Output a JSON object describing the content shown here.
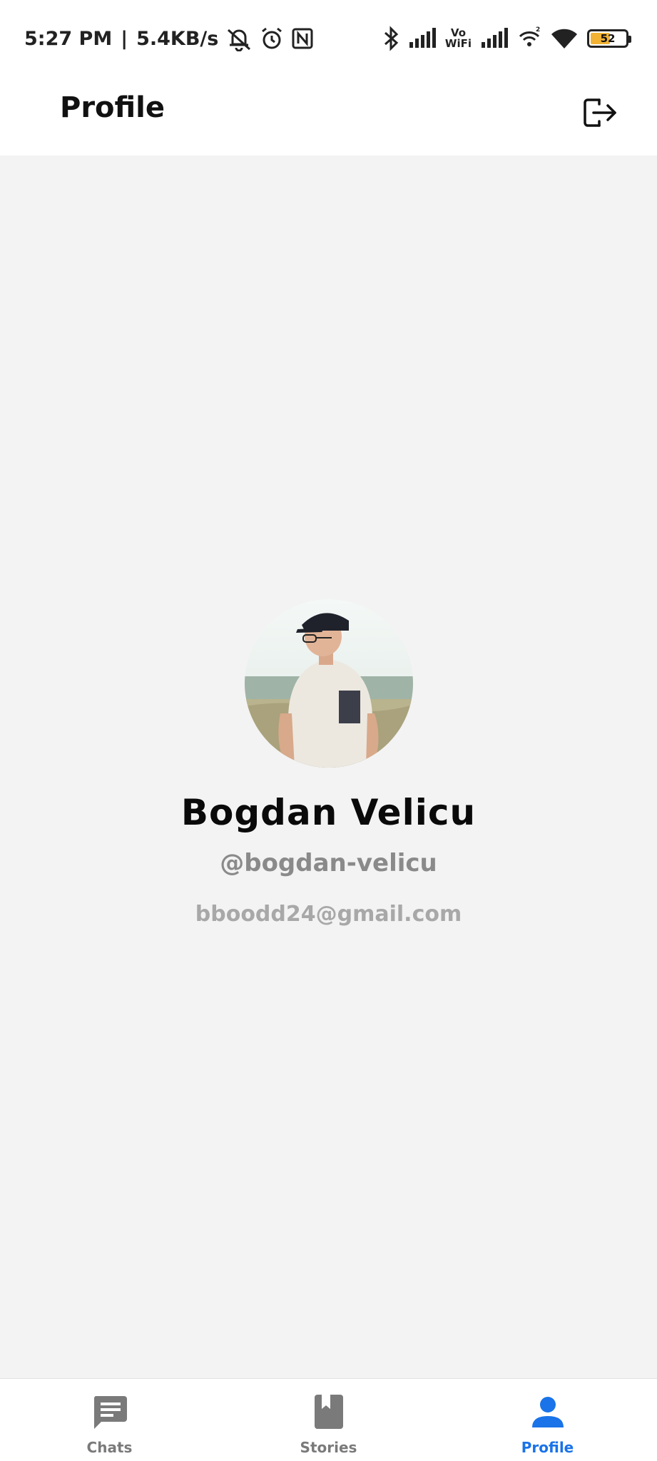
{
  "status_bar": {
    "time": "5:27 PM",
    "separator": "|",
    "network_speed": "5.4KB/s",
    "vowifi_top": "Vo",
    "vowifi_bottom": "WiFi",
    "battery_level": "52",
    "icons": [
      "bell-muted-icon",
      "alarm-icon",
      "nfc-icon",
      "bluetooth-icon",
      "signal-icon",
      "wifi-hotspot-icon",
      "wifi-icon",
      "battery-icon"
    ]
  },
  "header": {
    "title": "Profile",
    "logout_icon": "logout-icon"
  },
  "profile": {
    "display_name": "Bogdan Velicu",
    "username": "@bogdan-velicu",
    "email": "bboodd24@gmail.com"
  },
  "bottom_nav": {
    "items": [
      {
        "label": "Chats",
        "icon": "chat-icon",
        "active": false
      },
      {
        "label": "Stories",
        "icon": "book-icon",
        "active": false
      },
      {
        "label": "Profile",
        "icon": "person-icon",
        "active": true
      }
    ]
  },
  "colors": {
    "background": "#f3f3f3",
    "accent": "#1a73e8",
    "inactive": "#7a7a7a",
    "battery": "#f2b233"
  }
}
